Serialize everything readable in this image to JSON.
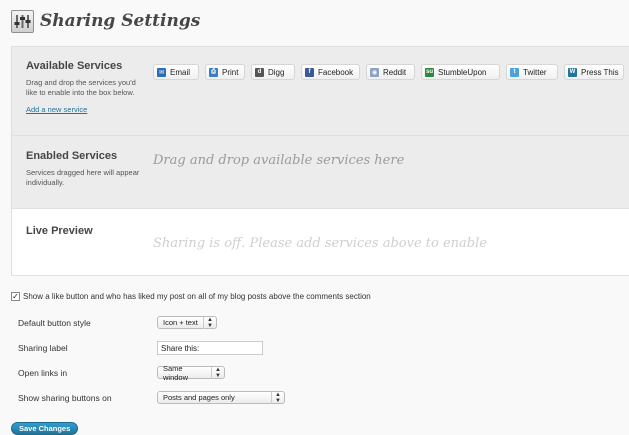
{
  "header": {
    "title": "Sharing Settings",
    "icon": "settings-sliders-icon"
  },
  "available": {
    "title": "Available Services",
    "description": "Drag and drop the services you'd like to enable into the box below.",
    "add_link": "Add a new service",
    "services": [
      {
        "label": "Email",
        "icon": "email-icon",
        "color": "#2a6fb5"
      },
      {
        "label": "Print",
        "icon": "print-icon",
        "color": "#3a7fc1"
      },
      {
        "label": "Digg",
        "icon": "digg-icon",
        "color": "#555555"
      },
      {
        "label": "Facebook",
        "icon": "facebook-icon",
        "color": "#3b5998"
      },
      {
        "label": "Reddit",
        "icon": "reddit-icon",
        "color": "#8aa4c8"
      },
      {
        "label": "StumbleUpon",
        "icon": "stumbleupon-icon",
        "color": "#2e8a3b"
      },
      {
        "label": "Twitter",
        "icon": "twitter-icon",
        "color": "#4aa3df"
      },
      {
        "label": "Press This",
        "icon": "wordpress-icon",
        "color": "#21759b"
      }
    ]
  },
  "enabled": {
    "title": "Enabled Services",
    "description": "Services dragged here will appear individually.",
    "drop_hint": "Drag and drop available services here"
  },
  "preview": {
    "title": "Live Preview",
    "message": "Sharing is off. Please add services above to enable"
  },
  "like_option": {
    "checked": true,
    "label": "Show a like button and who has liked my post on all of my blog posts above the comments section"
  },
  "form": {
    "button_style": {
      "label": "Default button style",
      "value": "Icon + text"
    },
    "sharing_label": {
      "label": "Sharing label",
      "value": "Share this:"
    },
    "open_links": {
      "label": "Open links in",
      "value": "Same window"
    },
    "show_buttons": {
      "label": "Show sharing buttons on",
      "value": "Posts and pages only"
    }
  },
  "save_button": "Save Changes",
  "colors": {
    "accent": "#21759b",
    "hint_text": "#999999",
    "preview_hint": "#d0d0d0"
  }
}
